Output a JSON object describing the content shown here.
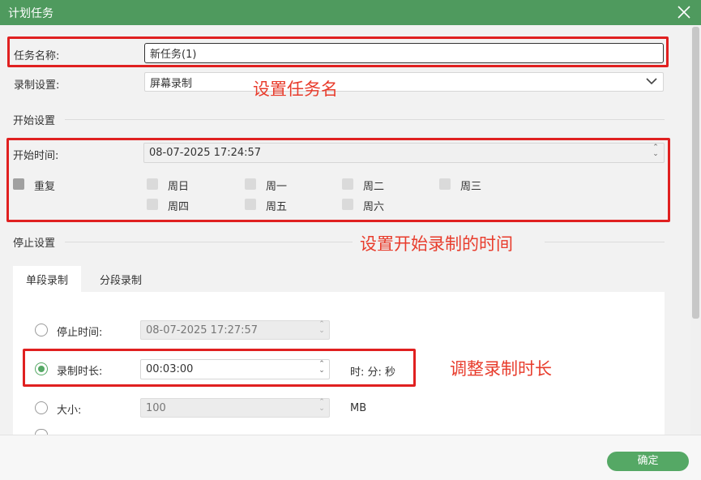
{
  "window": {
    "title": "计划任务",
    "close_icon": "close-icon"
  },
  "task_name": {
    "label": "任务名称:",
    "value": "新任务(1)"
  },
  "record_setting": {
    "label": "录制设置:",
    "selected": "屏幕录制"
  },
  "start_section": {
    "heading": "开始设置",
    "start_time_label": "开始时间:",
    "start_time_value": "08-07-2025 17:24:57",
    "repeat_label": "重复",
    "days": [
      "周日",
      "周一",
      "周二",
      "周三",
      "周四",
      "周五",
      "周六"
    ]
  },
  "stop_section": {
    "heading": "停止设置",
    "tabs": [
      "单段录制",
      "分段录制"
    ],
    "active_tab": 0,
    "stop_time_label": "停止时间:",
    "stop_time_value": "08-07-2025 17:27:57",
    "duration_label": "录制时长:",
    "duration_value": "00:03:00",
    "duration_unit": "时: 分: 秒",
    "size_label": "大小:",
    "size_value": "100",
    "size_unit": "MB",
    "selected_option": "duration"
  },
  "annotations": {
    "set_task_name": "设置任务名",
    "set_start_time": "设置开始录制的时间",
    "adjust_duration": "调整录制时长"
  },
  "footer": {
    "ok_label": "确定"
  },
  "colors": {
    "title_bar": "#4f9a5e",
    "accent": "#55a865",
    "annotation": "#e83c2c",
    "highlight_box": "#e02020"
  }
}
